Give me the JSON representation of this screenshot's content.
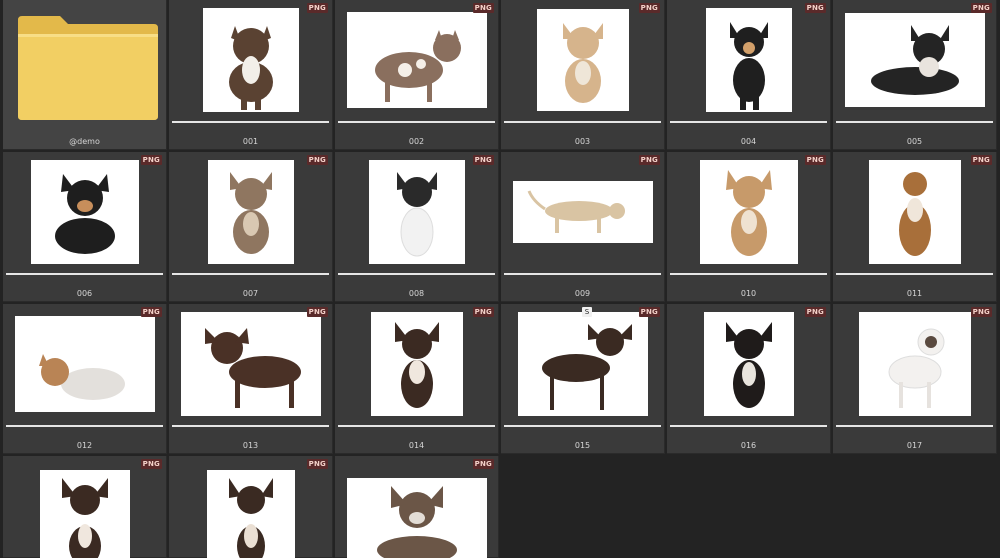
{
  "folder": {
    "label": "@demo",
    "icon": "folder-icon"
  },
  "badge_text": "PNG",
  "items": [
    {
      "label": "001",
      "fur": "#5a4232",
      "accent": "#f2efe9"
    },
    {
      "label": "002",
      "fur": "#8a6f5e",
      "accent": "#f5efe8"
    },
    {
      "label": "003",
      "fur": "#d6b48c",
      "accent": "#efe6d8"
    },
    {
      "label": "004",
      "fur": "#1f1f1f",
      "accent": "#d3a06a"
    },
    {
      "label": "005",
      "fur": "#242424",
      "accent": "#e9e4de"
    },
    {
      "label": "006",
      "fur": "#1e1e1e",
      "accent": "#c78e5b"
    },
    {
      "label": "007",
      "fur": "#8f7660",
      "accent": "#d9c8b2"
    },
    {
      "label": "008",
      "fur": "#2a2a2a",
      "accent": "#f2f2f2"
    },
    {
      "label": "009",
      "fur": "#d9c4a3",
      "accent": "#eee4d6"
    },
    {
      "label": "010",
      "fur": "#c79a6a",
      "accent": "#efe2d1"
    },
    {
      "label": "011",
      "fur": "#a86f3a",
      "accent": "#f0e6da"
    },
    {
      "label": "012",
      "fur": "#e3e0dc",
      "accent": "#b98455"
    },
    {
      "label": "013",
      "fur": "#4a3126",
      "accent": "#6b4a3a"
    },
    {
      "label": "014",
      "fur": "#3b2a22",
      "accent": "#f0e7de"
    },
    {
      "label": "015",
      "fur": "#3a2a22",
      "accent": "#eadfd3"
    },
    {
      "label": "016",
      "fur": "#1f1b1a",
      "accent": "#e8e4dd"
    },
    {
      "label": "017",
      "fur": "#f3f1ef",
      "accent": "#5a4a3f"
    },
    {
      "label": "",
      "fur": "#3b2a22",
      "accent": "#f0e7de"
    },
    {
      "label": "",
      "fur": "#3a2a22",
      "accent": "#eadfd3"
    },
    {
      "label": "",
      "fur": "#6b5647",
      "accent": "#e3ddd6"
    }
  ],
  "selected_badge": "S"
}
